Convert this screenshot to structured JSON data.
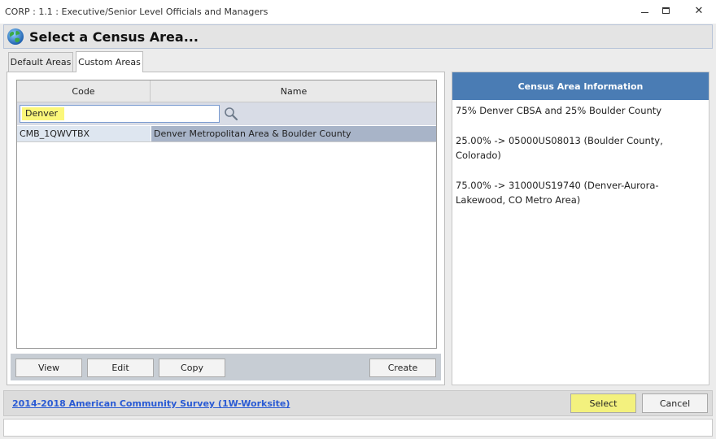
{
  "window": {
    "title": "CORP : 1.1 : Executive/Senior Level Officials and Managers",
    "close_glyph": "✕"
  },
  "header": {
    "title": "Select a Census Area...",
    "icon": "globe-icon"
  },
  "tabs": [
    {
      "label": "Default Areas",
      "active": false
    },
    {
      "label": "Custom Areas",
      "active": true
    }
  ],
  "grid": {
    "columns": [
      "Code",
      "Name"
    ],
    "filter_value": "Denver",
    "rows": [
      {
        "code": "CMB_1QWVTBX",
        "name": "Denver Metropolitan Area & Boulder County"
      }
    ]
  },
  "actions": {
    "view": "View",
    "edit": "Edit",
    "copy": "Copy",
    "create": "Create"
  },
  "info": {
    "title": "Census Area Information",
    "lines": [
      "75% Denver CBSA and 25% Boulder County",
      "25.00% -> 05000US08013 (Boulder County, Colorado)",
      "75.00% -> 31000US19740 (Denver-Aurora-Lakewood, CO Metro Area)"
    ]
  },
  "footer": {
    "survey_link": "2014-2018 American Community Survey (1W-Worksite)",
    "select": "Select",
    "cancel": "Cancel"
  },
  "colors": {
    "accent_blue": "#4a7cb4",
    "highlight_yellow": "#fbf77a",
    "link_blue": "#2a5bd4"
  }
}
